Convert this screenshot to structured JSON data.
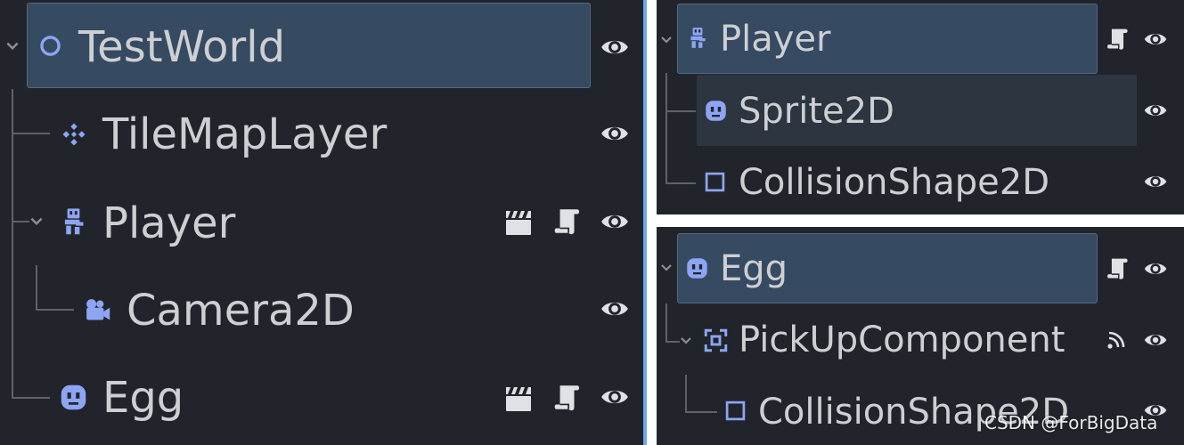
{
  "scene_tree_main": {
    "root": {
      "label": "TestWorld",
      "icon": "node2d-icon",
      "expanded": true,
      "selected": true
    },
    "children": [
      {
        "label": "TileMapLayer",
        "icon": "tilemaplayer-icon",
        "visible": true
      },
      {
        "label": "Player",
        "icon": "characterbody2d-icon",
        "expanded": true,
        "badges": [
          "scene-instance-icon",
          "script-icon"
        ],
        "visible": true,
        "children": [
          {
            "label": "Camera2D",
            "icon": "camera2d-icon",
            "visible": true
          }
        ]
      },
      {
        "label": "Egg",
        "icon": "sprite2d-icon",
        "badges": [
          "scene-instance-icon",
          "script-icon"
        ],
        "visible": true
      }
    ]
  },
  "scene_tree_player": {
    "root": {
      "label": "Player",
      "icon": "characterbody2d-icon",
      "expanded": true,
      "selected": true,
      "badges": [
        "script-icon"
      ]
    },
    "children": [
      {
        "label": "Sprite2D",
        "icon": "sprite2d-icon",
        "hovered": true,
        "visible": true
      },
      {
        "label": "CollisionShape2D",
        "icon": "collisionshape2d-icon",
        "visible": true
      }
    ]
  },
  "scene_tree_egg": {
    "root": {
      "label": "Egg",
      "icon": "sprite2d-icon",
      "expanded": true,
      "selected": true,
      "badges": [
        "script-icon"
      ]
    },
    "children": [
      {
        "label": "PickUpComponent",
        "icon": "area2d-icon",
        "expanded": true,
        "badges": [
          "signal-icon"
        ],
        "visible": true,
        "children": [
          {
            "label": "CollisionShape2D",
            "icon": "collisionshape2d-icon",
            "visible": true
          }
        ]
      }
    ]
  },
  "watermark": "CSDN @ForBigData",
  "colors": {
    "panel_bg": "#21252b",
    "selection_bg": "#364a62",
    "node_icon": "#8da5f3",
    "text": "#cdcfd2"
  }
}
